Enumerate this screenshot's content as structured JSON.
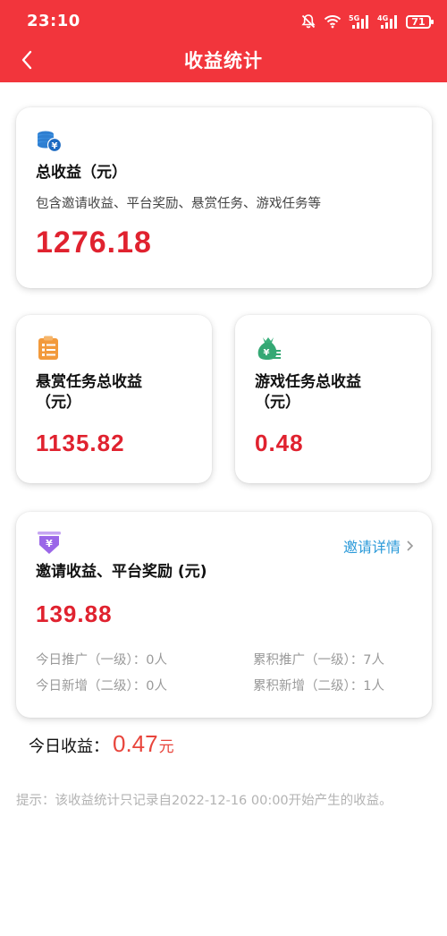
{
  "status": {
    "time": "23:10",
    "network_a": "5G",
    "network_b": "4G",
    "battery": "71"
  },
  "nav": {
    "title": "收益统计",
    "back_icon": "chevron-left-icon"
  },
  "total": {
    "title": "总收益（元）",
    "desc": "包含邀请收益、平台奖励、悬赏任务、游戏任务等",
    "value": "1276.18",
    "icon": "coins-icon"
  },
  "task": {
    "title_line1": "悬赏任务总收益",
    "title_line2": "（元）",
    "value": "1135.82",
    "icon": "clipboard-icon"
  },
  "game": {
    "title_line1": "游戏任务总收益",
    "title_line2": "（元）",
    "value": "0.48",
    "icon": "money-bag-icon"
  },
  "invite": {
    "title": "邀请收益、平台奖励 (元)",
    "link": "邀请详情",
    "value": "139.88",
    "icon": "yuan-down-icon",
    "today_promo": "今日推广（一级）：0人",
    "total_promo": "累积推广（一级）：7人",
    "today_new": "今日新增（二级）：0人",
    "total_new": "累积新增（二级）：1人"
  },
  "today": {
    "label": "今日收益：",
    "value": "0.47",
    "unit": "元"
  },
  "tip": "提示：该收益统计只记录自2022-12-16 00:00开始产生的收益。",
  "colors": {
    "brand": "#f2353c",
    "value_red": "#e0222f",
    "link_blue": "#2b9ad9",
    "today_red": "#e8453c"
  }
}
